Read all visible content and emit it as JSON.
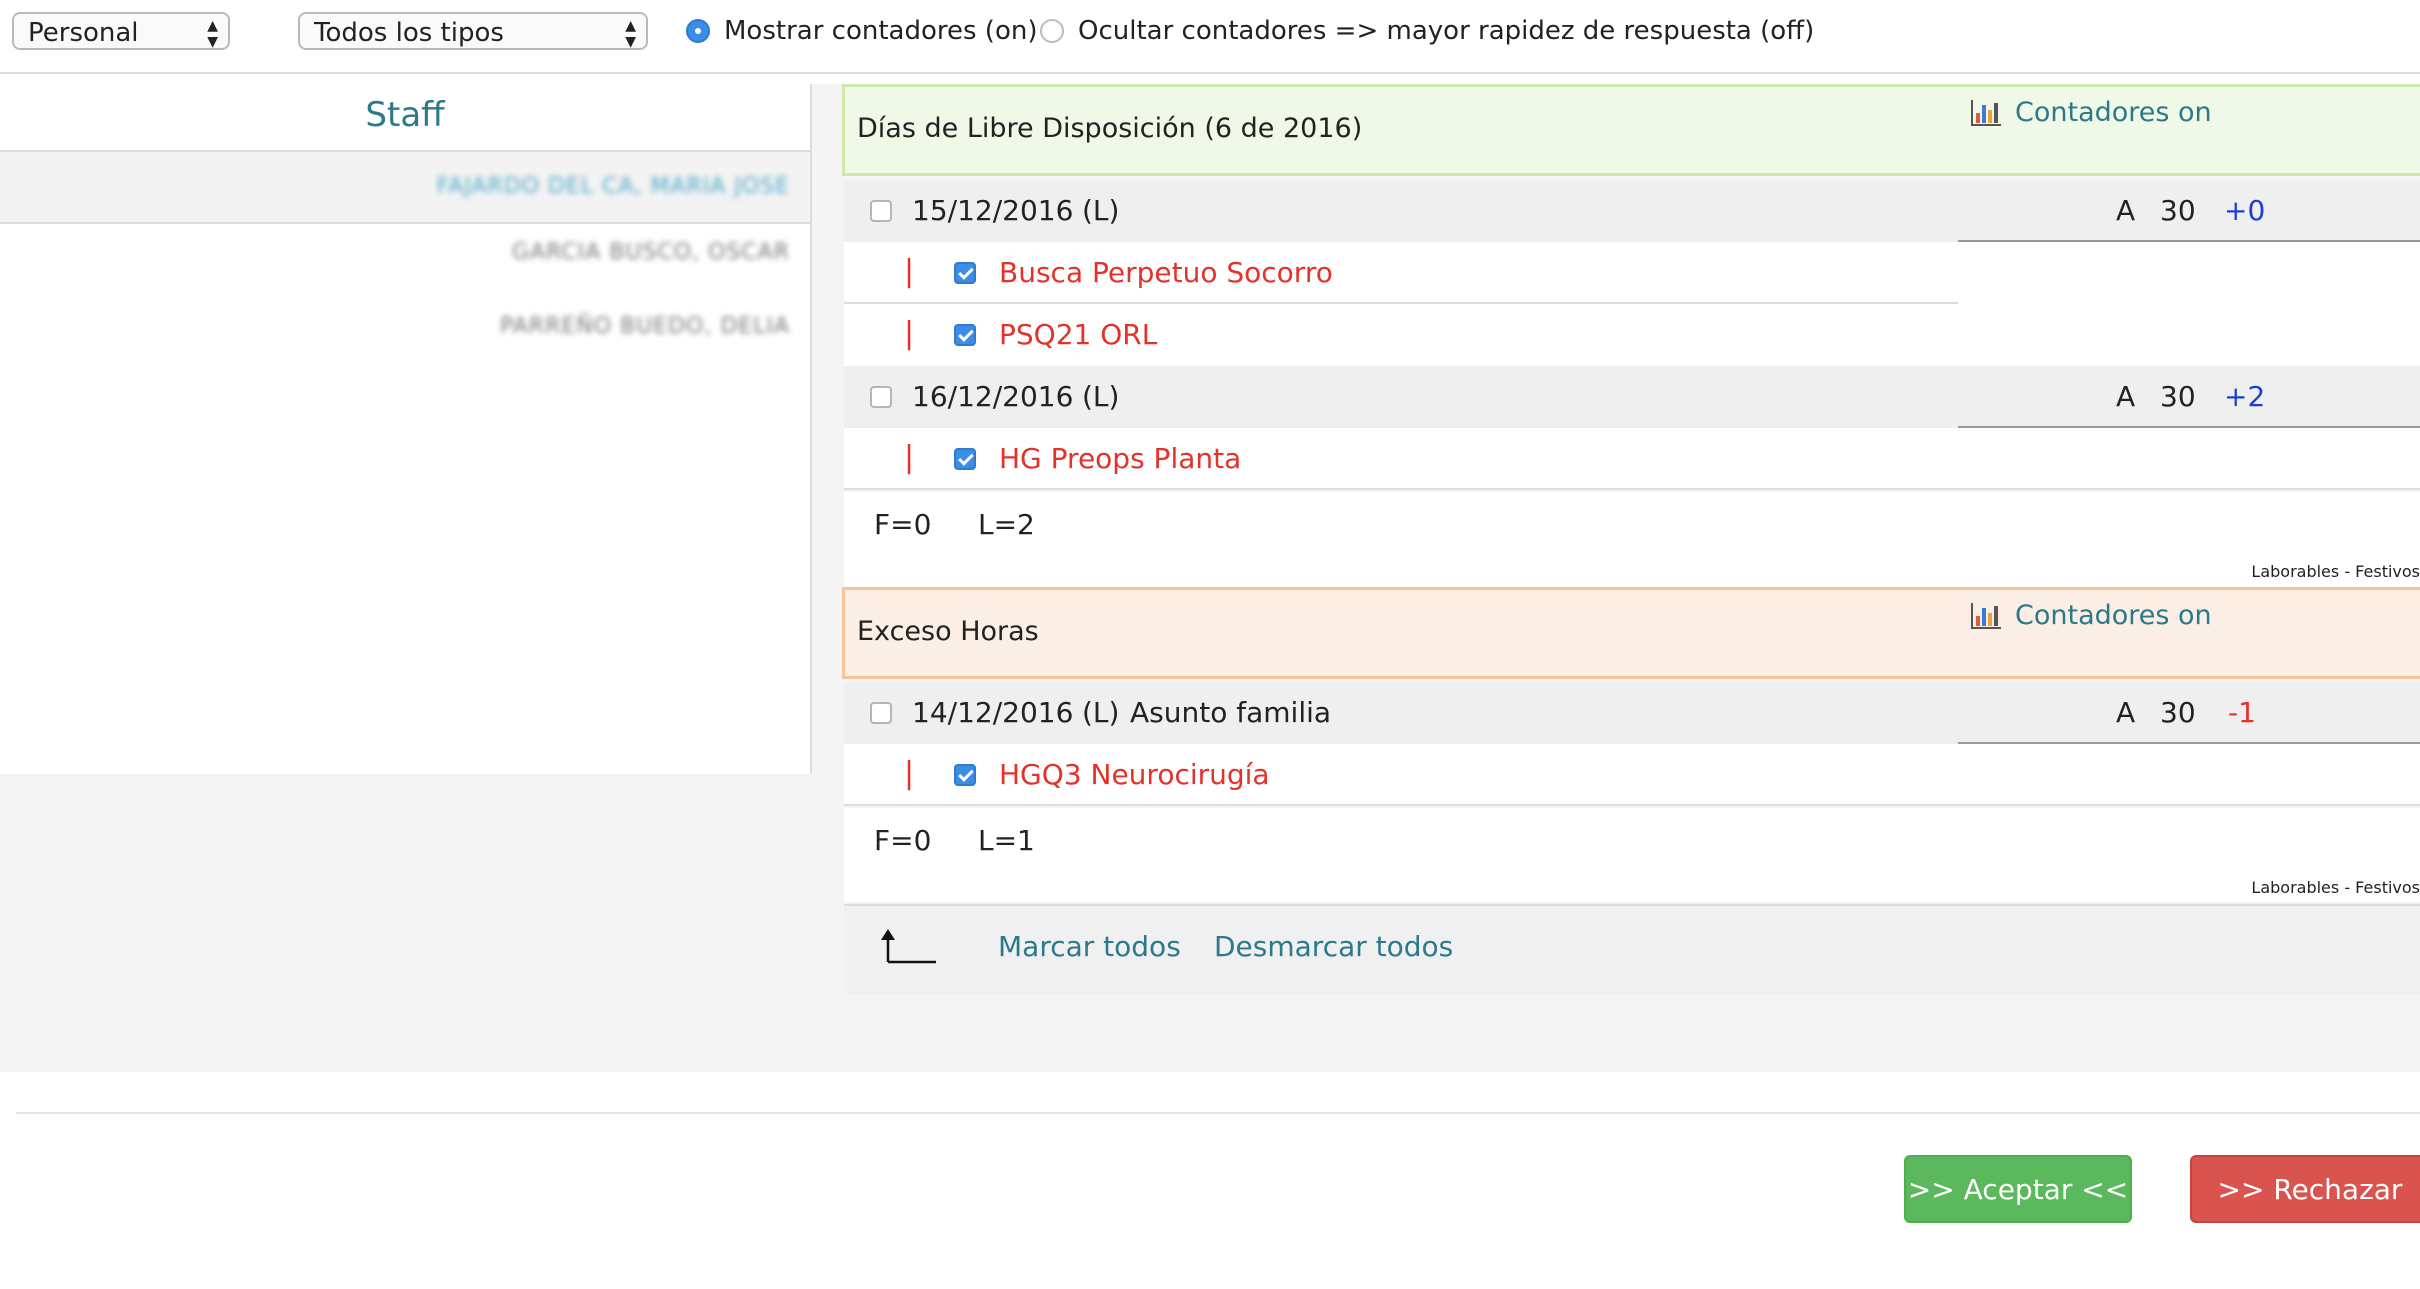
{
  "toolbar": {
    "select_person": "Personal",
    "select_type": "Todos los tipos",
    "radio_on_label": "Mostrar contadores (on)",
    "radio_off_label": "Ocultar contadores => mayor rapidez de respuesta (off)"
  },
  "staff": {
    "header": "Staff",
    "names": [
      "FAJARDO DEL CA, MARIA JOSE",
      "GARCIA BUSCO, OSCAR",
      "PARREÑO BUEDO, DELIA"
    ]
  },
  "groups": [
    {
      "title": "Días de Libre Disposición (6 de 2016)",
      "counter_label": "Contadores on",
      "color": "#f0f9e8",
      "dates": [
        {
          "date": "15/12/2016",
          "type": "(L)",
          "note": "",
          "code": "A",
          "num": "30",
          "delta": "+0",
          "items": [
            "Busca Perpetuo Socorro",
            "PSQ21 ORL"
          ]
        },
        {
          "date": "16/12/2016",
          "type": "(L)",
          "note": "",
          "code": "A",
          "num": "30",
          "delta": "+2",
          "items": [
            "HG Preops Planta"
          ]
        }
      ],
      "summary": {
        "f": "F=0",
        "l": "L=2",
        "legend": "Laborables - Festivos"
      }
    },
    {
      "title": "Exceso Horas",
      "counter_label": "Contadores on",
      "color": "#fbeee4",
      "dates": [
        {
          "date": "14/12/2016",
          "type": "(L)",
          "note": "Asunto familia",
          "code": "A",
          "num": "30",
          "delta": "-1",
          "items": [
            "HGQ3 Neurocirugía"
          ]
        }
      ],
      "summary": {
        "f": "F=0",
        "l": "L=1",
        "legend": "Laborables - Festivos"
      }
    }
  ],
  "footer": {
    "mark_all": "Marcar todos",
    "unmark_all": "Desmarcar todos"
  },
  "buttons": {
    "accept": ">> Aceptar <<",
    "reject": ">> Rechazar <<"
  },
  "colors": {
    "accent": "#2b7a89",
    "item_red": "#e4322b",
    "positive_delta": "#1a3fd6",
    "negative_delta": "#e4322b",
    "accept": "#5cb85c",
    "reject": "#d9534f"
  }
}
